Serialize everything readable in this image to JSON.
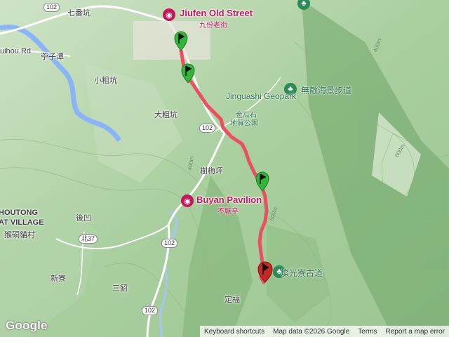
{
  "poi": {
    "jiufen": {
      "name_en": "Jiufen Old Street",
      "name_zh": "九份老街"
    },
    "buyan": {
      "name_en": "Buyan Pavilion",
      "name_zh": "不厭亭"
    },
    "trail_zh": "無敵海景步道",
    "canguang": "燦光寮古道"
  },
  "geo": {
    "name_en": "Jinguashi Geopark",
    "name_zh_1": "金瓜石",
    "name_zh_2": "地質公園"
  },
  "places": {
    "qifankeng": "七番坑",
    "ziyutan": "苧子潭",
    "xiaocukeng": "小粗坑",
    "dacukeng": "大粗坑",
    "shumeiping": "樹梅坪",
    "houao": "後凹",
    "mouliao": "新寮",
    "sandiao": "三貂",
    "dingfu": "定福",
    "houtong_1": "HOUTONG",
    "houtong_2": "AT VILLAGE",
    "houtong_zh": "猴硐貓村",
    "ruihou": "uihou Rd"
  },
  "roads": {
    "r102": "102",
    "r37": "北37"
  },
  "contours": {
    "c400a": "400m",
    "c600": "600m",
    "c400b": "400m",
    "c600b": "600m"
  },
  "footer": {
    "shortcuts": "Keyboard shortcuts",
    "mapdata": "Map data ©2026 Google",
    "terms": "Terms",
    "report": "Report a map error"
  },
  "brand": {
    "logo": "Google"
  },
  "colors": {
    "route": "#e8515f",
    "marker_start": "#33b43b",
    "marker_end": "#c62828",
    "poi": "#c2185b",
    "park": "#2e8b57"
  }
}
